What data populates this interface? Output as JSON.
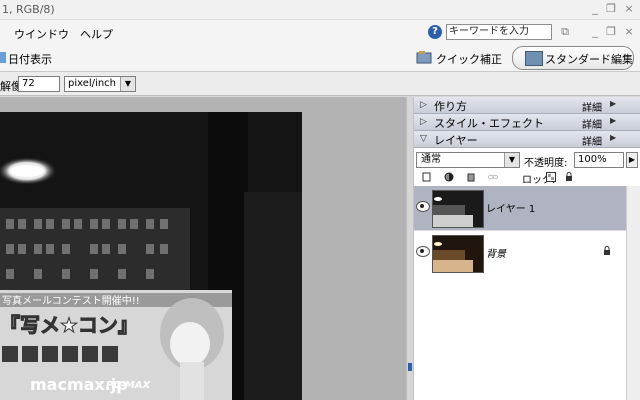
{
  "window": {
    "title": "1, RGB/8)"
  },
  "menu": {
    "items": [
      "ウインドウ",
      "ヘルプ"
    ]
  },
  "search": {
    "placeholder": "キーワードを入力"
  },
  "toolbar": {
    "date_label": "日付表示",
    "quick_fix": "クイック補正",
    "standard_edit": "スタンダード編集"
  },
  "options": {
    "resolution_label": "解像度:",
    "resolution_value": "72",
    "unit": "pixel/inch"
  },
  "panels": {
    "recipes": {
      "title": "作り方",
      "detail": "詳細"
    },
    "styles": {
      "title": "スタイル・エフェクト",
      "detail": "詳細"
    },
    "layers": {
      "title": "レイヤー",
      "detail": "詳細"
    }
  },
  "layers_panel": {
    "blend_mode": "通常",
    "opacity_label": "不透明度:",
    "opacity_value": "100%",
    "lock_label": "ロック:",
    "layers": [
      {
        "name": "レイヤー 1",
        "selected": true
      },
      {
        "name": "背景",
        "locked": true
      }
    ]
  },
  "photo": {
    "banner_line1": "写真メールコンテスト開催中!!",
    "banner_line2": "『写メ★コン』",
    "banner_url": "macmax.jp",
    "banner_brand": "PC-MAX"
  },
  "colors": {
    "accent": "#2d5fb0",
    "panel_header": "#d4d8e2",
    "selected_row": "#b0b4c2"
  }
}
